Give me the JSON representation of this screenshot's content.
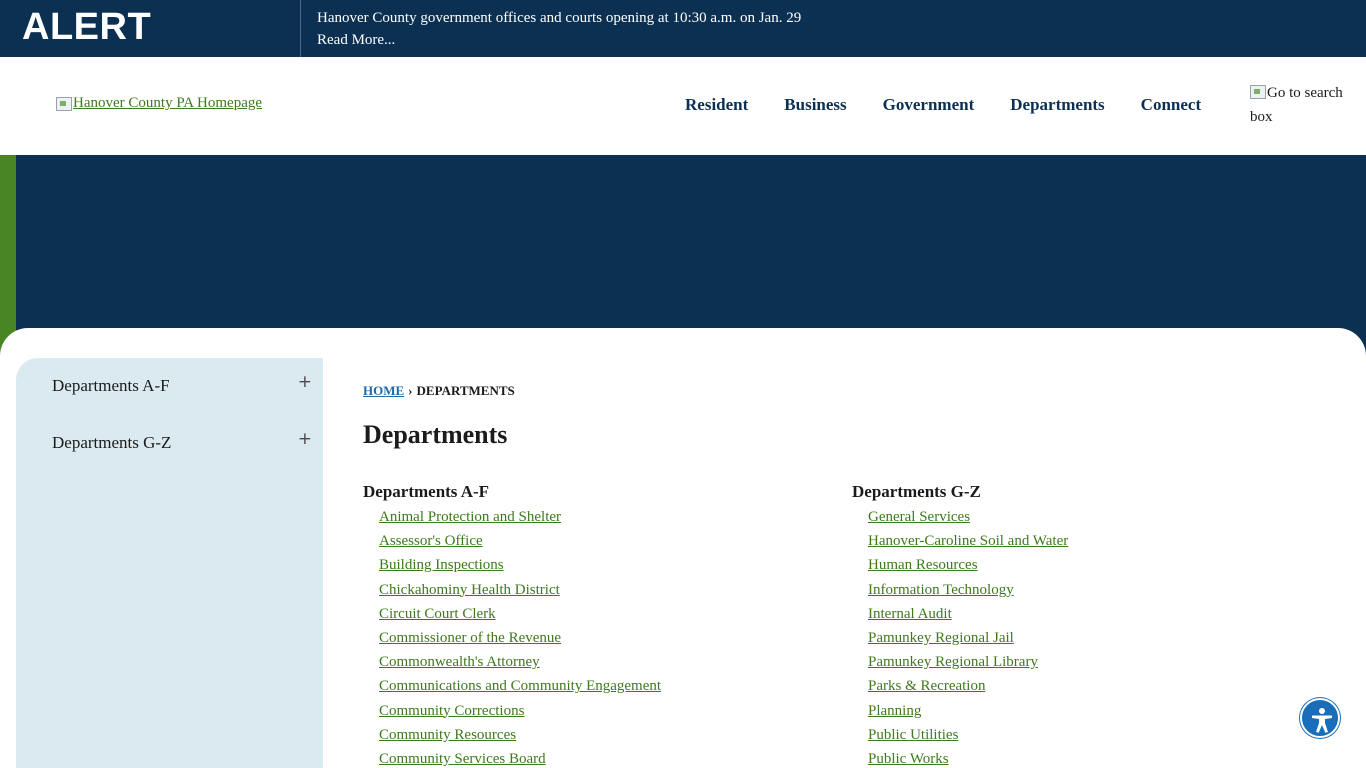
{
  "alert": {
    "label": "ALERT",
    "line1": "Hanover County government offices and courts opening at 10:30 a.m. on Jan. 29",
    "line2": "Read More..."
  },
  "header": {
    "logo_alt": "Hanover County PA Homepage",
    "nav": [
      "Resident",
      "Business",
      "Government",
      "Departments",
      "Connect"
    ],
    "search_alt": "Go to search box"
  },
  "sidebar": {
    "items": [
      {
        "label": "Departments A-F",
        "toggle": "+"
      },
      {
        "label": "Departments G-Z",
        "toggle": "+"
      }
    ]
  },
  "breadcrumb": {
    "home": "HOME",
    "separator": "›",
    "current": "DEPARTMENTS"
  },
  "page_title": "Departments",
  "columns": [
    {
      "heading": "Departments A-F",
      "links": [
        "Animal Protection and Shelter",
        "Assessor's Office",
        "Building Inspections",
        "Chickahominy Health District",
        "Circuit Court Clerk",
        "Commissioner of the Revenue",
        "Commonwealth's Attorney",
        "Communications and Community Engagement",
        "Community Corrections",
        "Community Resources",
        "Community Services Board"
      ]
    },
    {
      "heading": "Departments G-Z",
      "links": [
        "General Services",
        "Hanover-Caroline Soil and Water",
        "Human Resources",
        "Information Technology",
        "Internal Audit",
        "Pamunkey Regional Jail",
        "Pamunkey Regional Library",
        "Parks & Recreation",
        "Planning",
        "Public Utilities",
        "Public Works"
      ]
    }
  ],
  "colors": {
    "navy": "#0c3052",
    "green": "#4a8525",
    "link_green": "#3e7a1d",
    "sidebar_bg": "#dbeaf0",
    "breadcrumb_link": "#1f6aa5",
    "a11y_blue": "#1a6db8"
  },
  "icons": {
    "accessibility": "accessibility-person-icon",
    "logo": "broken-image-icon",
    "search": "broken-image-icon"
  }
}
